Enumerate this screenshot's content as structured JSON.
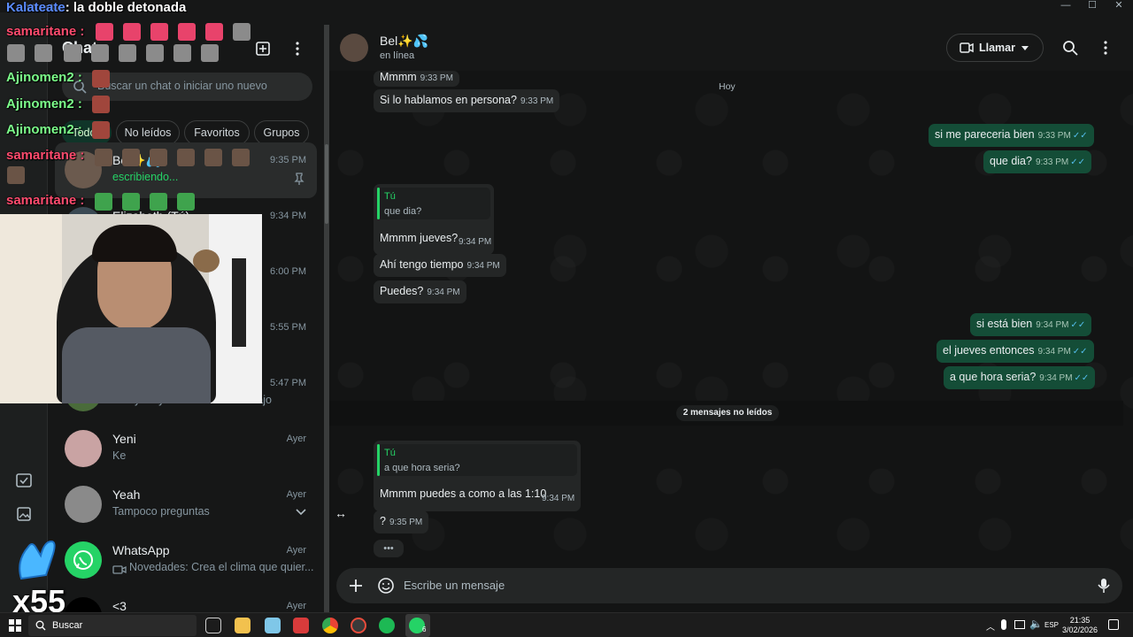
{
  "window": {
    "app_title": "WhatsApp",
    "minimize": "—",
    "maximize": "☐",
    "close": "✕"
  },
  "sidebar": {
    "title": "Chat",
    "search_placeholder": "Buscar un chat o iniciar uno nuevo",
    "filters": [
      "Todos",
      "No leídos",
      "Favoritos",
      "Grupos"
    ],
    "chats": [
      {
        "name": "Bel✨💦",
        "time": "9:35 PM",
        "preview": "escribiendo..."
      },
      {
        "name": "Elizabeth (Tú)",
        "time": "9:34 PM",
        "preview": ""
      },
      {
        "name": "",
        "time": "6:00 PM",
        "preview": ""
      },
      {
        "name": "",
        "time": "5:55 PM",
        "preview": ""
      },
      {
        "name": "",
        "time": "5:47 PM",
        "preview": "Estoy en yendo a mi otro trabajo"
      },
      {
        "name": "Yeni",
        "time": "Ayer",
        "preview": "Ke"
      },
      {
        "name": "Yeah",
        "time": "Ayer",
        "preview": "Tampoco preguntas"
      },
      {
        "name": "WhatsApp",
        "time": "Ayer",
        "preview": "Novedades: Crea el clima que quier..."
      },
      {
        "name": "<3",
        "time": "Ayer",
        "preview": ""
      }
    ]
  },
  "chat": {
    "contact_name": "Bel✨💦",
    "status": "en línea",
    "call_label": "Llamar",
    "date_chip": "Hoy",
    "unread_label": "2 mensajes no leídos",
    "composer_placeholder": "Escribe un mensaje",
    "messages": [
      {
        "dir": "in",
        "text": "Mmmm",
        "time": "9:33 PM"
      },
      {
        "dir": "in",
        "text": "Si lo hablamos en persona?",
        "time": "9:33 PM"
      },
      {
        "dir": "out",
        "text": "si me pareceria bien",
        "time": "9:33 PM"
      },
      {
        "dir": "out",
        "text": "que dia?",
        "time": "9:33 PM"
      },
      {
        "dir": "in",
        "quote_author": "Tú",
        "quote_text": "que dia?",
        "text": "Mmmm jueves?",
        "time": "9:34 PM"
      },
      {
        "dir": "in",
        "text": "Ahí tengo tiempo",
        "time": "9:34 PM"
      },
      {
        "dir": "in",
        "text": "Puedes?",
        "time": "9:34 PM"
      },
      {
        "dir": "out",
        "text": "si está bien",
        "time": "9:34 PM"
      },
      {
        "dir": "out",
        "text": "el jueves entonces",
        "time": "9:34 PM"
      },
      {
        "dir": "out",
        "text": "a que hora seria?",
        "time": "9:34 PM"
      },
      {
        "dir": "in",
        "quote_author": "Tú",
        "quote_text": "a que hora seria?",
        "text": "Mmmm puedes a como a las 1:10",
        "time": "9:34 PM"
      },
      {
        "dir": "in",
        "text": "?",
        "time": "9:35 PM"
      }
    ],
    "typing_indicator": "•••"
  },
  "overlay": {
    "top_line_user": "Kalateate",
    "top_line_text": ": la doble detonada",
    "chat_users": [
      "samaritane :",
      "Ajinomen2 :",
      "Ajinomen2 :",
      "Ajinomen2 :",
      "samaritane :",
      "samaritane :"
    ],
    "badge_text": "x55"
  },
  "taskbar": {
    "search_label": "Buscar",
    "language": "ESP",
    "time": "21:35",
    "date": "3/02/2026",
    "whatsapp_badge": "6"
  },
  "colors": {
    "accent_green": "#25d366",
    "outgoing_bubble": "#144d37",
    "incoming_bubble": "#242626",
    "read_tick": "#53bdeb"
  }
}
